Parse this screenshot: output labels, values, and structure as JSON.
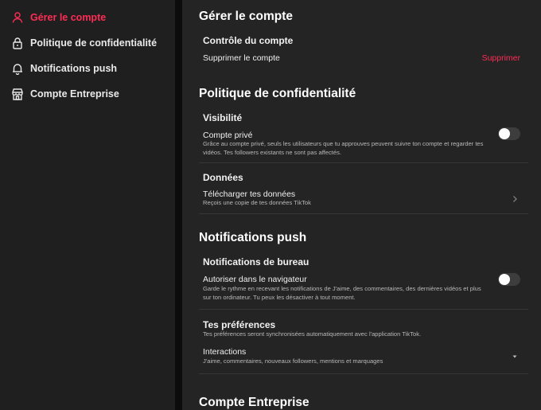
{
  "sidebar": {
    "items": [
      {
        "label": "Gérer le compte",
        "icon": "person-icon",
        "active": true
      },
      {
        "label": "Politique de confidentialité",
        "icon": "lock-icon"
      },
      {
        "label": "Notifications push",
        "icon": "bell-icon"
      },
      {
        "label": "Compte Entreprise",
        "icon": "store-icon"
      }
    ]
  },
  "colors": {
    "accent": "#fe2c55",
    "sidebar_bg": "#1f1f1f",
    "main_bg": "#242424",
    "toggle_off": "#3d3d3d"
  },
  "sections": {
    "account": {
      "title": "Gérer le compte",
      "control_heading": "Contrôle du compte",
      "delete_label": "Supprimer le compte",
      "delete_action": "Supprimer"
    },
    "privacy": {
      "title": "Politique de confidentialité",
      "visibility_heading": "Visibilité",
      "private_title": "Compte privé",
      "private_desc": "Grâce au compte privé, seuls les utilisateurs que tu approuves peuvent suivre ton compte et regarder tes vidéos. Tes followers existants ne sont pas affectés.",
      "private_enabled": false,
      "data_heading": "Données",
      "download_title": "Télécharger tes données",
      "download_desc": "Reçois une copie de tes données TikTok"
    },
    "notifications": {
      "title": "Notifications push",
      "desktop_heading": "Notifications de bureau",
      "browser_title": "Autoriser dans le navigateur",
      "browser_desc": "Garde le rythme en recevant les notifications de J'aime, des commentaires, des dernières vidéos et plus sur ton ordinateur. Tu peux les désactiver à tout moment.",
      "browser_enabled": false,
      "prefs_heading": "Tes préférences",
      "prefs_desc": "Tes préférences seront synchronisées automatiquement avec l'application TikTok.",
      "interactions_title": "Interactions",
      "interactions_desc": "J'aime, commentaires, nouveaux followers, mentions et marquages"
    },
    "business": {
      "title": "Compte Entreprise"
    }
  }
}
